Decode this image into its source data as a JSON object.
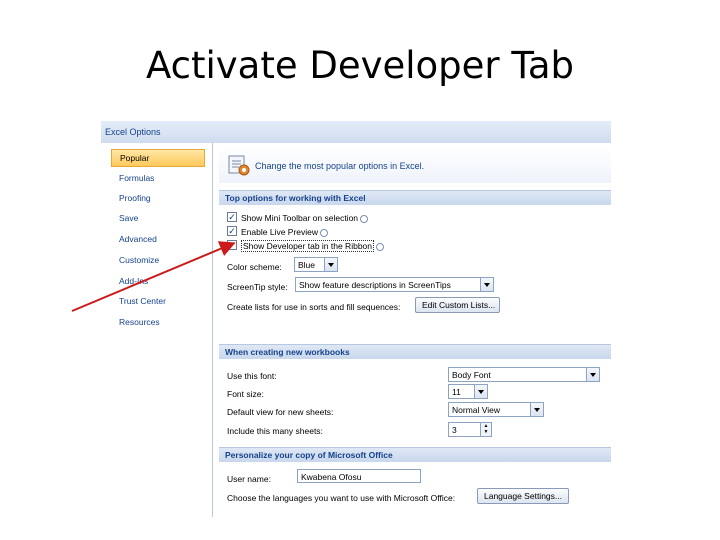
{
  "slide": {
    "title": "Activate Developer Tab"
  },
  "dialog": {
    "title": "Excel Options",
    "nav": [
      "Popular",
      "Formulas",
      "Proofing",
      "Save",
      "Advanced",
      "Customize",
      "Add-Ins",
      "Trust Center",
      "Resources"
    ],
    "header": "Change the most popular options in Excel.",
    "sections": {
      "top": "Top options for working with Excel",
      "new_workbooks": "When creating new workbooks",
      "personalize": "Personalize your copy of Microsoft Office"
    },
    "checkboxes": {
      "mini_toolbar": "Show Mini Toolbar on selection",
      "live_preview": "Enable Live Preview",
      "developer_tab": "Show Developer tab in the Ribbon"
    },
    "check_mark": "✓",
    "color_scheme": {
      "label": "Color scheme:",
      "value": "Blue"
    },
    "screentip": {
      "label": "ScreenTip style:",
      "value": "Show feature descriptions in ScreenTips"
    },
    "custom_lists": {
      "label": "Create lists for use in sorts and fill sequences:",
      "button": "Edit Custom Lists..."
    },
    "font": {
      "label": "Use this font:",
      "value": "Body Font"
    },
    "font_size": {
      "label": "Font size:",
      "value": "11"
    },
    "default_view": {
      "label": "Default view for new sheets:",
      "value": "Normal View"
    },
    "sheet_count": {
      "label": "Include this many sheets:",
      "value": "3"
    },
    "user_name": {
      "label": "User name:",
      "value": "Kwabena Ofosu"
    },
    "languages": {
      "label": "Choose the languages you want to use with Microsoft Office:",
      "button": "Language Settings..."
    }
  },
  "colors": {
    "accent": "#15428b",
    "arrow": "#cc1a1a",
    "selected_nav": "#ffc95a"
  }
}
